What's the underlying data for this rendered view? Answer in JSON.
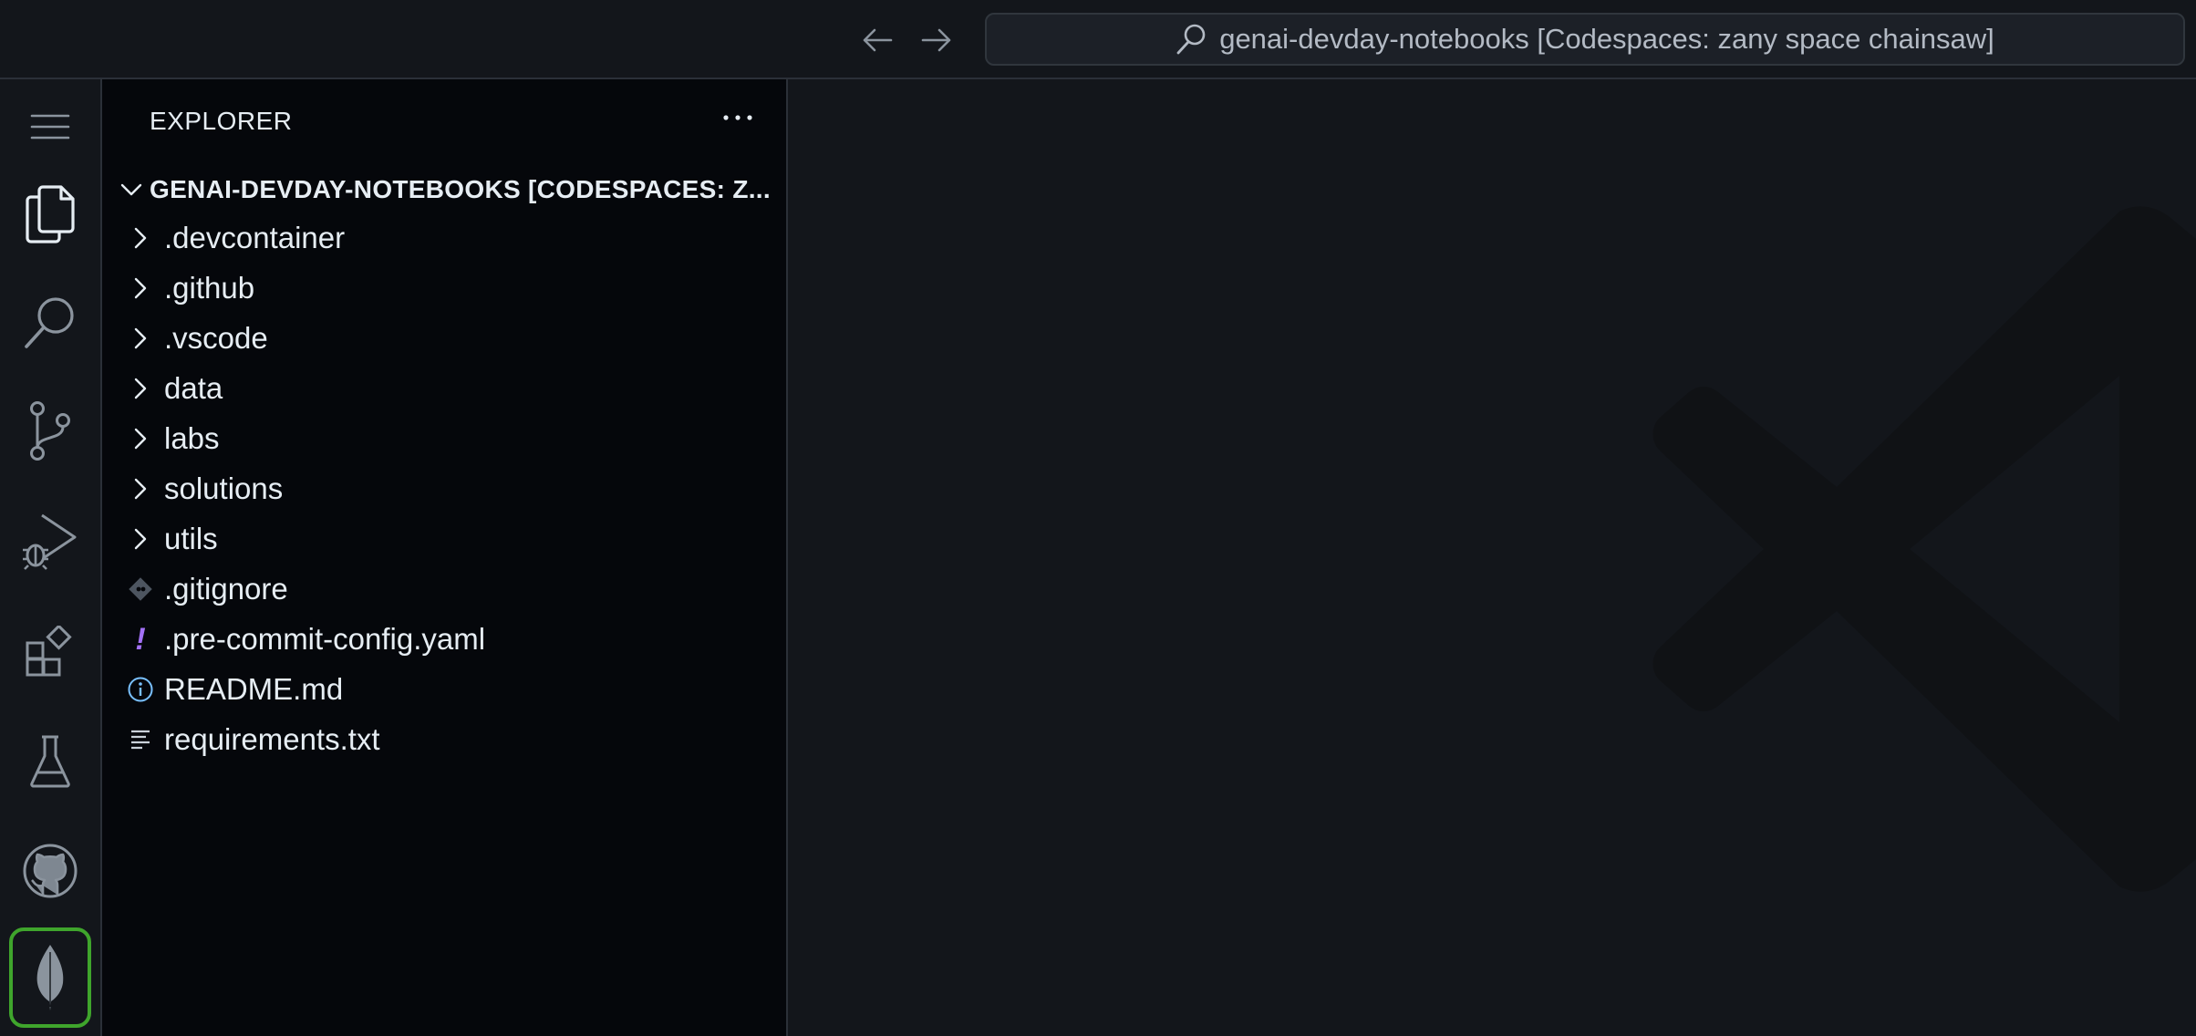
{
  "titlebar": {
    "back_icon": "arrow-left-icon",
    "forward_icon": "arrow-right-icon",
    "search_icon": "search-icon",
    "command_center_text": "genai-devday-notebooks [Codespaces: zany space chainsaw]"
  },
  "activity_bar": {
    "items": [
      {
        "name": "menu",
        "icon": "hamburger-menu-icon"
      },
      {
        "name": "explorer",
        "icon": "files-icon",
        "active": true
      },
      {
        "name": "search",
        "icon": "search-icon"
      },
      {
        "name": "source-control",
        "icon": "source-control-icon"
      },
      {
        "name": "run-and-debug",
        "icon": "run-debug-icon"
      },
      {
        "name": "extensions",
        "icon": "extensions-icon"
      },
      {
        "name": "testing",
        "icon": "beaker-icon"
      },
      {
        "name": "github",
        "icon": "github-icon"
      },
      {
        "name": "mongodb",
        "icon": "mongodb-leaf-icon",
        "accent": "#3fa52c"
      }
    ]
  },
  "sidebar": {
    "header": "EXPLORER",
    "root_label": "GENAI-DEVDAY-NOTEBOOKS [CODESPACES: Z...",
    "items": [
      {
        "label": ".devcontainer",
        "type": "folder"
      },
      {
        "label": ".github",
        "type": "folder"
      },
      {
        "label": ".vscode",
        "type": "folder"
      },
      {
        "label": "data",
        "type": "folder"
      },
      {
        "label": "labs",
        "type": "folder"
      },
      {
        "label": "solutions",
        "type": "folder"
      },
      {
        "label": "utils",
        "type": "folder"
      },
      {
        "label": ".gitignore",
        "type": "file",
        "icon": "git-file-icon"
      },
      {
        "label": ".pre-commit-config.yaml",
        "type": "file",
        "icon": "yaml-exclamation-icon"
      },
      {
        "label": "README.md",
        "type": "file",
        "icon": "info-icon"
      },
      {
        "label": "requirements.txt",
        "type": "file",
        "icon": "text-lines-icon"
      }
    ]
  },
  "colors": {
    "background": "#13161b",
    "sidebar_background": "#05070b",
    "text": "#e6edf3",
    "muted_icon": "#8b949e",
    "mongodb_green": "#3fa52c",
    "yaml_purple": "#a371f7",
    "info_blue": "#79c0ff"
  }
}
